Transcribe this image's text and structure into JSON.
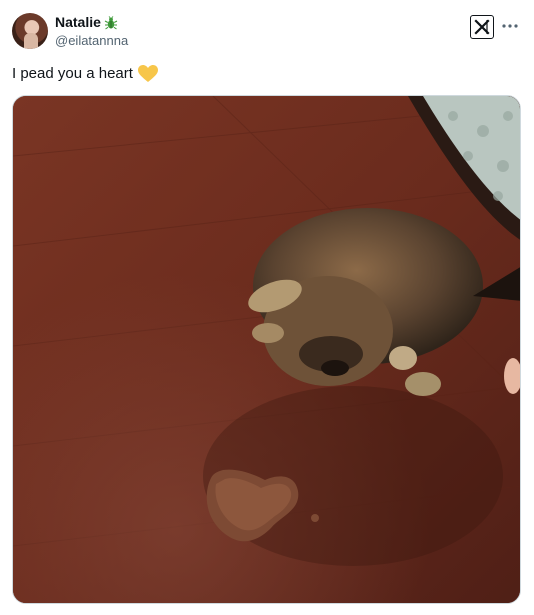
{
  "author": {
    "display_name": "Natalie",
    "handle": "@eilatannna",
    "badge_icon": "bug-icon",
    "avatar": "user-avatar"
  },
  "header": {
    "logo_icon": "x-logo-icon",
    "more_icon": "more-options-icon"
  },
  "tweet": {
    "text": "I pead you a heart",
    "emoji_icon": "yellow-heart-icon"
  },
  "media": {
    "subject": "photo"
  },
  "colors": {
    "heart": "#f7c64a",
    "badge": "#3f9a3a",
    "text": "#0f1419",
    "muted": "#536471"
  }
}
